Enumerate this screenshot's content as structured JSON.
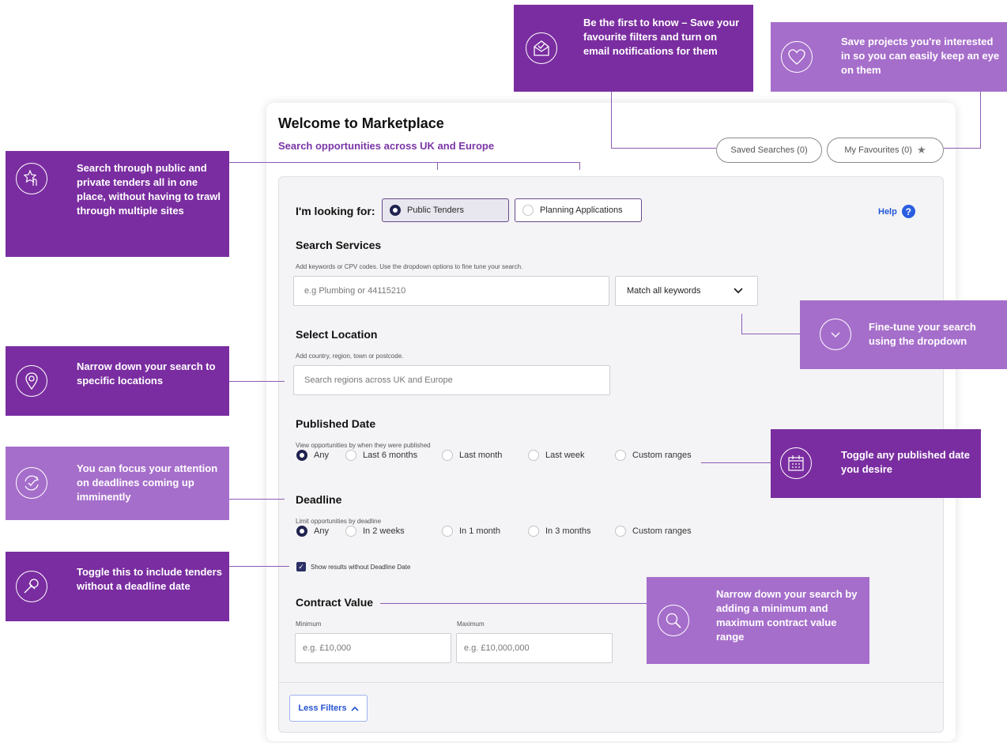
{
  "header": {
    "title": "Welcome to Marketplace",
    "subtitle": "Search opportunities across UK and Europe",
    "saved_searches": "Saved Searches (0)",
    "my_favourites": "My Favourites (0)"
  },
  "looking_for": {
    "label": "I'm looking for:",
    "options": [
      "Public Tenders",
      "Planning Applications"
    ],
    "selected": "Public Tenders",
    "help": "Help"
  },
  "services": {
    "title": "Search Services",
    "hint": "Add keywords or CPV codes. Use the dropdown options to fine tune your search.",
    "placeholder": "e.g Plumbing or 44115210",
    "match_value": "Match all keywords"
  },
  "location": {
    "title": "Select Location",
    "hint": "Add country, region, town or postcode.",
    "placeholder": "Search regions across UK and Europe"
  },
  "published": {
    "title": "Published Date",
    "hint": "View opportunities by when they were published",
    "options": [
      "Any",
      "Last 6 months",
      "Last month",
      "Last week",
      "Custom ranges"
    ],
    "selected": "Any"
  },
  "deadline": {
    "title": "Deadline",
    "hint": "Limit opportunities by deadline",
    "options": [
      "Any",
      "In 2 weeks",
      "In 1 month",
      "In 3 months",
      "Custom ranges"
    ],
    "selected": "Any",
    "checkbox_label": "Show results without Deadline Date",
    "checkbox_checked": true
  },
  "contract": {
    "title": "Contract Value",
    "min_label": "Minimum",
    "max_label": "Maximum",
    "min_placeholder": "e.g. £10,000",
    "max_placeholder": "e.g. £10,000,000"
  },
  "footer": {
    "less_filters": "Less Filters"
  },
  "callouts": {
    "email": "Be the first to know – Save your favourite filters and turn on email notifications for them",
    "favourites": "Save projects you're interested in so you can easily keep an eye on them",
    "search": "Search through public and private tenders all in one place, without having to trawl through multiple sites",
    "dropdown": "Fine-tune your search using the dropdown",
    "location": "Narrow down your search to specific locations",
    "deadline": "You can focus your attention on deadlines coming up imminently",
    "published": "Toggle any published date you desire",
    "no_deadline": "Toggle this to include tenders without a deadline date",
    "contract": "Narrow down your search by adding a minimum and maximum contract value range"
  },
  "colors": {
    "callout_dark": "#7a2da0",
    "callout_light": "#a66ecb",
    "accent_purple": "#7a35a6",
    "link_blue": "#2457d6",
    "radio_navy": "#20234f"
  },
  "icons": {
    "email": "envelope-check-icon",
    "favourites": "heart-icon",
    "search": "star-touch-icon",
    "dropdown": "chevron-circle-icon",
    "location": "map-pin-icon",
    "deadline": "refresh-check-icon",
    "published": "calendar-icon",
    "no_deadline": "pin-icon",
    "contract": "magnifier-icon"
  }
}
